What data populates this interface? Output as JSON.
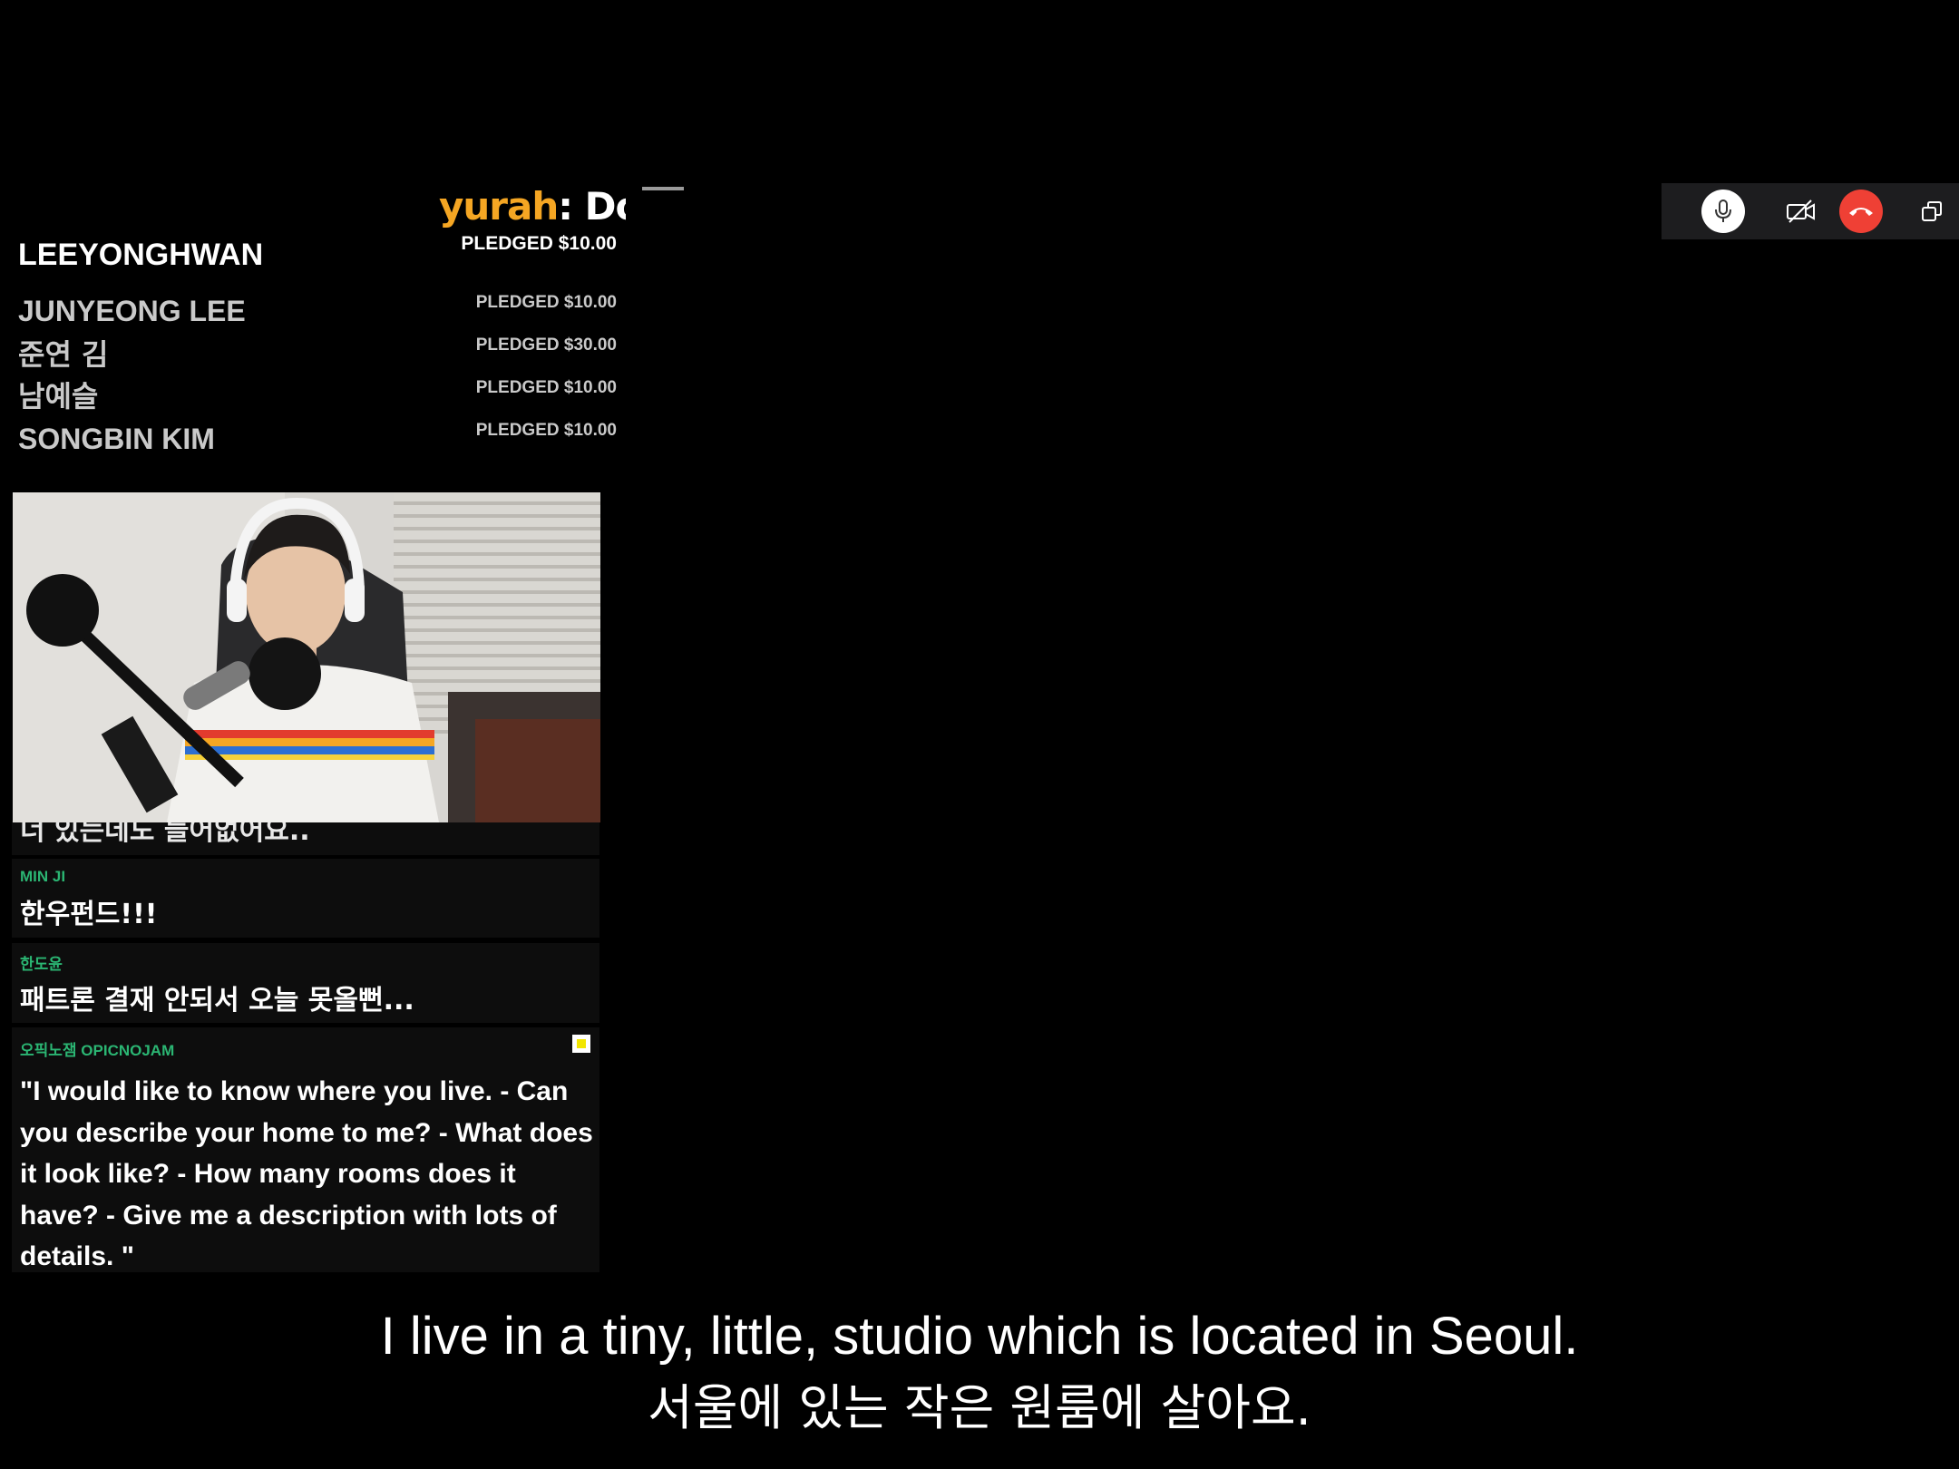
{
  "ticker": {
    "name": "yurah",
    "message": ": Donating"
  },
  "pledges": {
    "top": {
      "name": "LEEYONGHWAN",
      "amount": "PLEDGED $10.00"
    },
    "rows": [
      {
        "name": "JUNYEONG LEE",
        "amount": "PLEDGED $10.00"
      },
      {
        "name": "준연 김",
        "amount": "PLEDGED $30.00"
      },
      {
        "name": "남예슬",
        "amount": "PLEDGED $10.00"
      },
      {
        "name": "SONGBIN KIM",
        "amount": "PLEDGED $10.00"
      }
    ]
  },
  "chat": {
    "cut_off_text": "너 있는데도 들어없어요..",
    "messages": [
      {
        "user": "MIN JI",
        "text": "한우펀드!!!"
      },
      {
        "user": "한도윤",
        "text": "패트론 결재 안되서 오늘 못올뻔..."
      },
      {
        "user": "오픽노잼 OPICNOJAM",
        "text": "\"I would like to know where you live. - Can you describe your home to me? - What does it look like? - How many rooms does it have? - Give me a description with lots of details. \""
      }
    ]
  },
  "call_controls": {
    "mic": "microphone-icon",
    "camera": "camera-off-icon",
    "end": "hang-up-icon",
    "popout": "pop-out-icon",
    "end_color": "#ef4035"
  },
  "subtitles": {
    "english": "I live in a tiny, little, studio which is located in Seoul.",
    "korean": "서울에 있는 작은 원룸에 살아요."
  },
  "colors": {
    "ticker_name": "#f5a623",
    "chat_user": "#2bb673",
    "background": "#000000"
  }
}
